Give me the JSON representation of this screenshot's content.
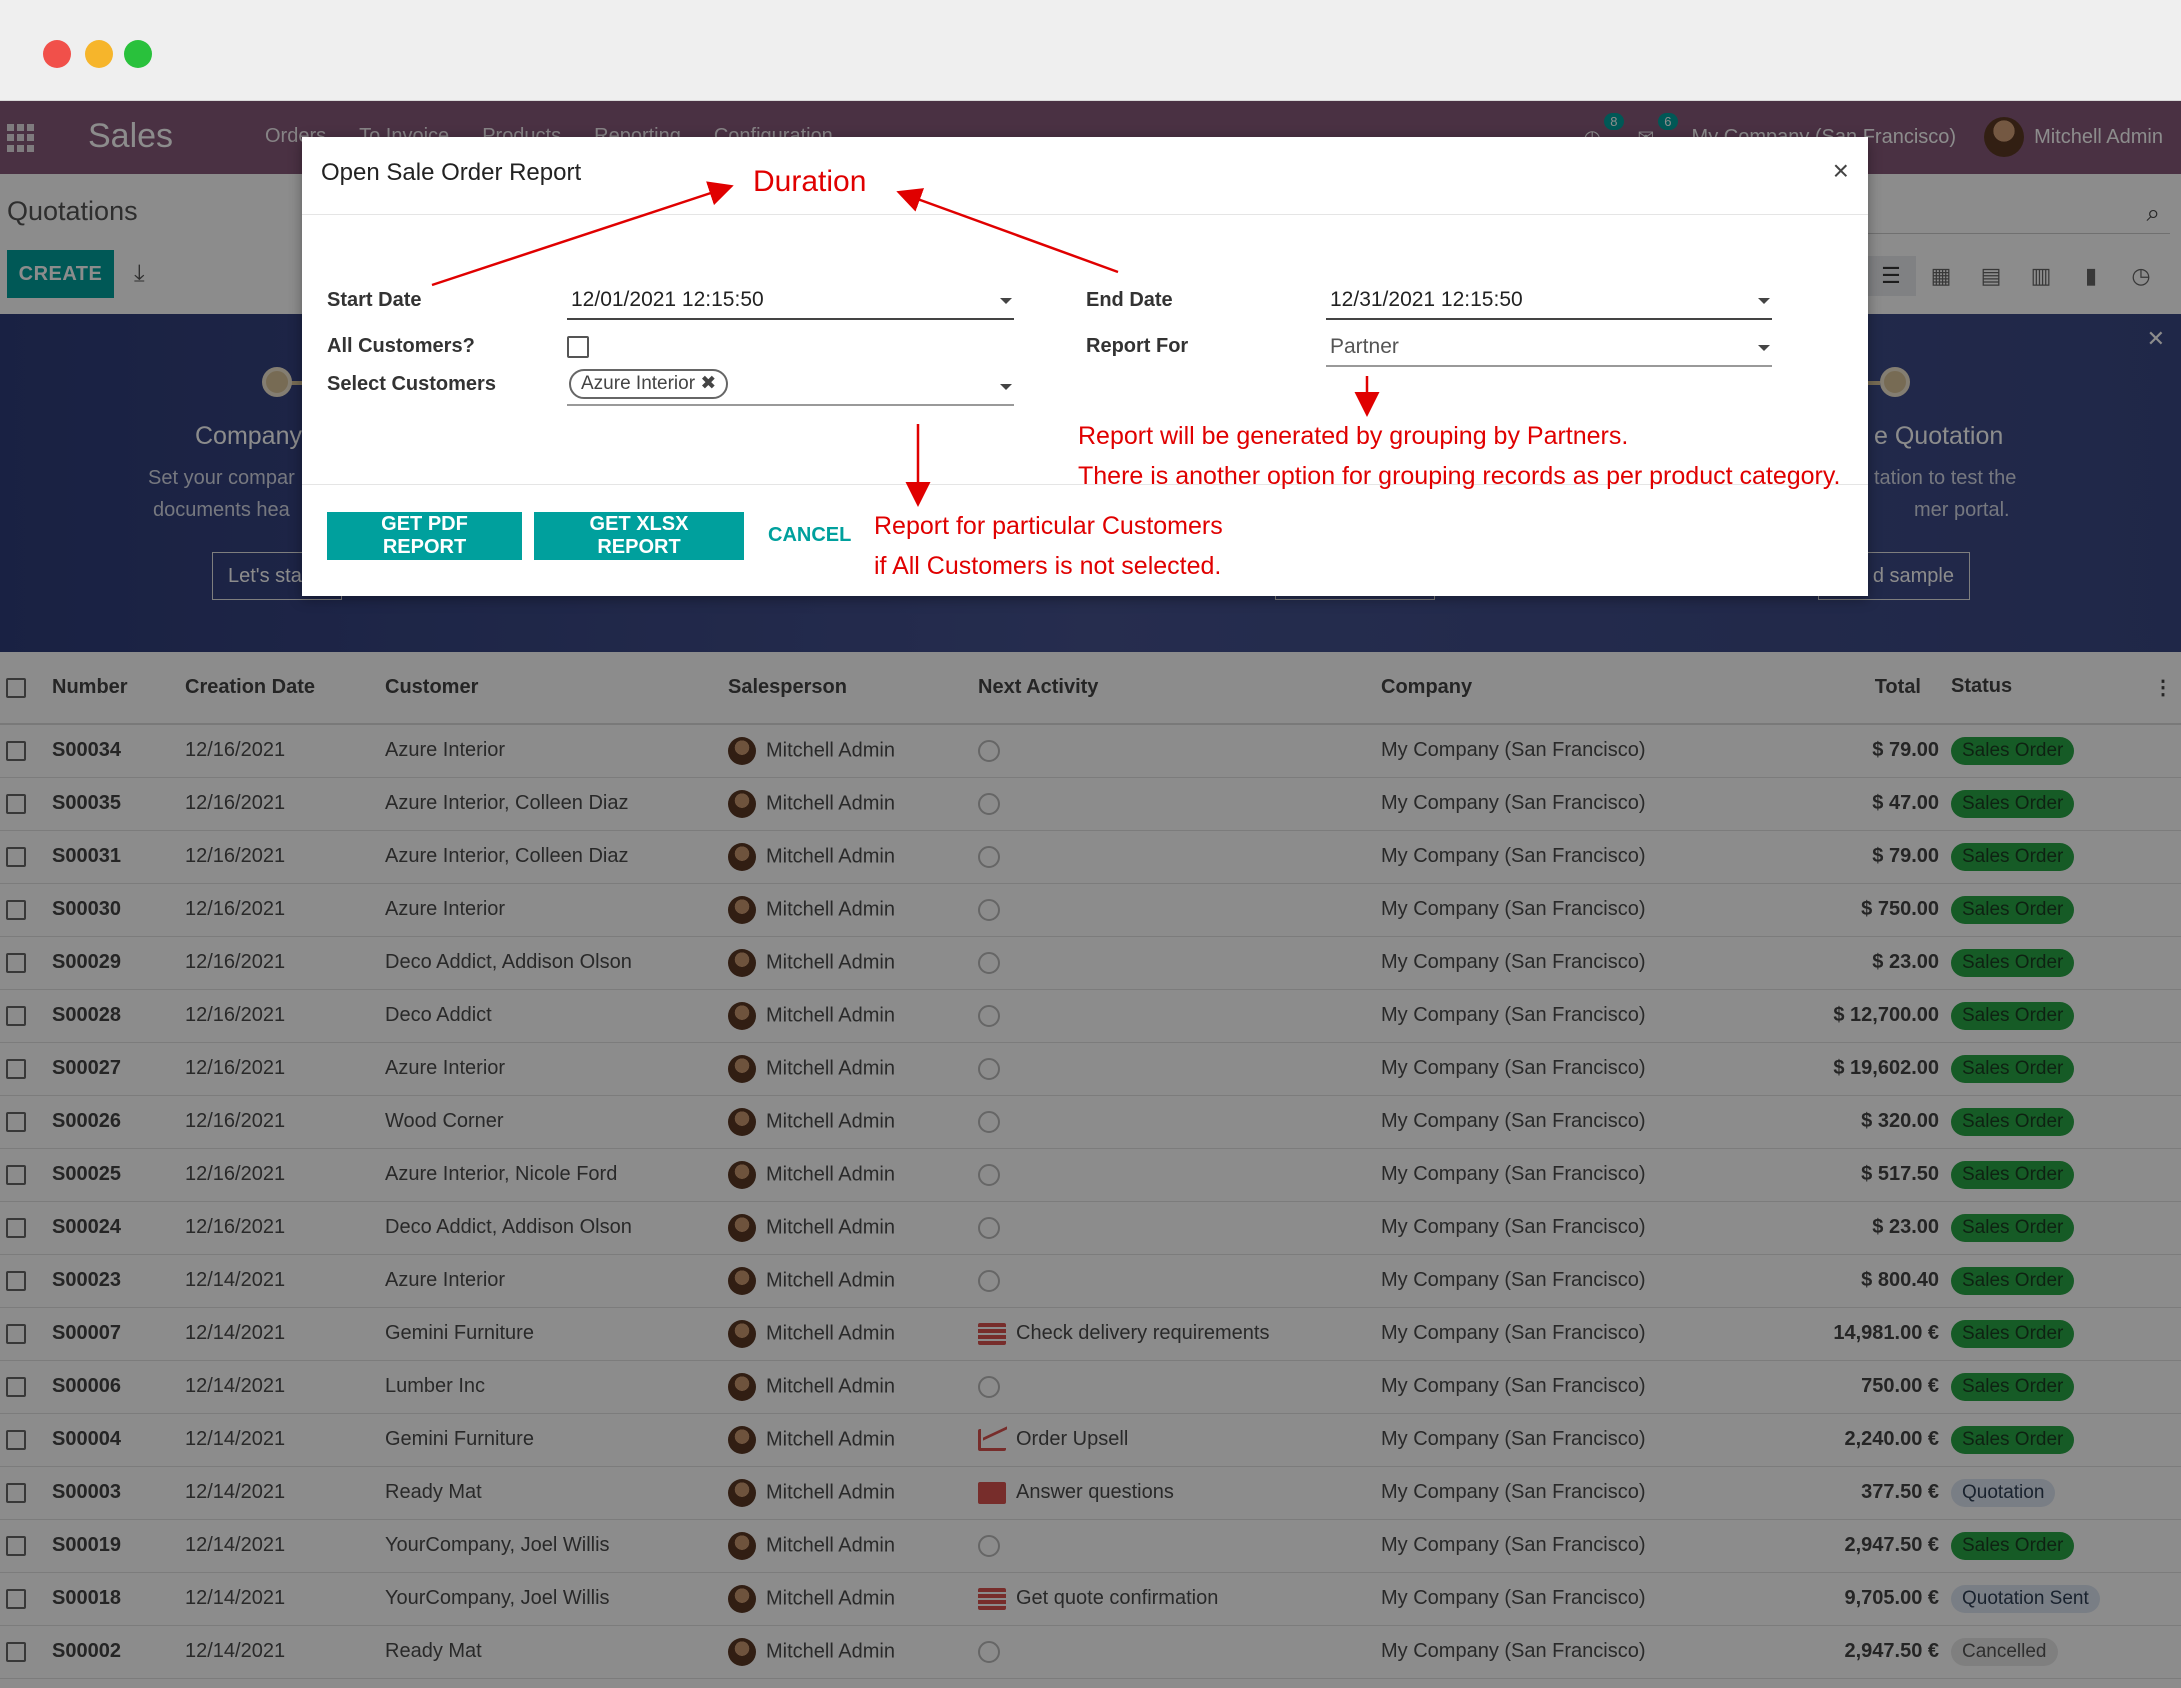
{
  "navbar": {
    "app_title": "Sales",
    "menu": [
      "Orders",
      "To Invoice",
      "Products",
      "Reporting",
      "Configuration"
    ],
    "activity_count": "8",
    "message_count": "6",
    "company": "My Company (San Francisco)",
    "user": "Mitchell Admin"
  },
  "control": {
    "breadcrumb": "Quotations",
    "create_label": "CREATE"
  },
  "banner": {
    "left_title": "Company",
    "left_text_1": "Set your compar",
    "left_text_2": "documents hea",
    "left_button": "Let's sta",
    "right_title": "e Quotation",
    "right_text_1": "tation to test the",
    "right_text_2": "mer portal.",
    "right_button": "d sample"
  },
  "table": {
    "headers": [
      "Number",
      "Creation Date",
      "Customer",
      "Salesperson",
      "Next Activity",
      "Company",
      "Total",
      "Status"
    ],
    "rows": [
      {
        "number": "S00034",
        "date": "12/16/2021",
        "customer": "Azure Interior",
        "salesperson": "Mitchell Admin",
        "activity": "",
        "activity_icon": "clock-icon",
        "company": "My Company (San Francisco)",
        "total": "$ 79.00",
        "status": "Sales Order",
        "status_kind": "sale"
      },
      {
        "number": "S00035",
        "date": "12/16/2021",
        "customer": "Azure Interior, Colleen Diaz",
        "salesperson": "Mitchell Admin",
        "activity": "",
        "activity_icon": "clock-icon",
        "company": "My Company (San Francisco)",
        "total": "$ 47.00",
        "status": "Sales Order",
        "status_kind": "sale"
      },
      {
        "number": "S00031",
        "date": "12/16/2021",
        "customer": "Azure Interior, Colleen Diaz",
        "salesperson": "Mitchell Admin",
        "activity": "",
        "activity_icon": "clock-icon",
        "company": "My Company (San Francisco)",
        "total": "$ 79.00",
        "status": "Sales Order",
        "status_kind": "sale"
      },
      {
        "number": "S00030",
        "date": "12/16/2021",
        "customer": "Azure Interior",
        "salesperson": "Mitchell Admin",
        "activity": "",
        "activity_icon": "clock-icon",
        "company": "My Company (San Francisco)",
        "total": "$ 750.00",
        "status": "Sales Order",
        "status_kind": "sale"
      },
      {
        "number": "S00029",
        "date": "12/16/2021",
        "customer": "Deco Addict, Addison Olson",
        "salesperson": "Mitchell Admin",
        "activity": "",
        "activity_icon": "clock-icon",
        "company": "My Company (San Francisco)",
        "total": "$ 23.00",
        "status": "Sales Order",
        "status_kind": "sale"
      },
      {
        "number": "S00028",
        "date": "12/16/2021",
        "customer": "Deco Addict",
        "salesperson": "Mitchell Admin",
        "activity": "",
        "activity_icon": "clock-icon",
        "company": "My Company (San Francisco)",
        "total": "$ 12,700.00",
        "status": "Sales Order",
        "status_kind": "sale"
      },
      {
        "number": "S00027",
        "date": "12/16/2021",
        "customer": "Azure Interior",
        "salesperson": "Mitchell Admin",
        "activity": "",
        "activity_icon": "clock-icon",
        "company": "My Company (San Francisco)",
        "total": "$ 19,602.00",
        "status": "Sales Order",
        "status_kind": "sale"
      },
      {
        "number": "S00026",
        "date": "12/16/2021",
        "customer": "Wood Corner",
        "salesperson": "Mitchell Admin",
        "activity": "",
        "activity_icon": "clock-icon",
        "company": "My Company (San Francisco)",
        "total": "$ 320.00",
        "status": "Sales Order",
        "status_kind": "sale"
      },
      {
        "number": "S00025",
        "date": "12/16/2021",
        "customer": "Azure Interior, Nicole Ford",
        "salesperson": "Mitchell Admin",
        "activity": "",
        "activity_icon": "clock-icon",
        "company": "My Company (San Francisco)",
        "total": "$ 517.50",
        "status": "Sales Order",
        "status_kind": "sale"
      },
      {
        "number": "S00024",
        "date": "12/16/2021",
        "customer": "Deco Addict, Addison Olson",
        "salesperson": "Mitchell Admin",
        "activity": "",
        "activity_icon": "clock-icon",
        "company": "My Company (San Francisco)",
        "total": "$ 23.00",
        "status": "Sales Order",
        "status_kind": "sale"
      },
      {
        "number": "S00023",
        "date": "12/14/2021",
        "customer": "Azure Interior",
        "salesperson": "Mitchell Admin",
        "activity": "",
        "activity_icon": "clock-icon",
        "company": "My Company (San Francisco)",
        "total": "$ 800.40",
        "status": "Sales Order",
        "status_kind": "sale"
      },
      {
        "number": "S00007",
        "date": "12/14/2021",
        "customer": "Gemini Furniture",
        "salesperson": "Mitchell Admin",
        "activity": "Check delivery requirements",
        "activity_icon": "tasks-icon",
        "company": "My Company (San Francisco)",
        "total": "14,981.00 €",
        "status": "Sales Order",
        "status_kind": "sale"
      },
      {
        "number": "S00006",
        "date": "12/14/2021",
        "customer": "Lumber Inc",
        "salesperson": "Mitchell Admin",
        "activity": "",
        "activity_icon": "clock-icon",
        "company": "My Company (San Francisco)",
        "total": "750.00 €",
        "status": "Sales Order",
        "status_kind": "sale"
      },
      {
        "number": "S00004",
        "date": "12/14/2021",
        "customer": "Gemini Furniture",
        "salesperson": "Mitchell Admin",
        "activity": "Order Upsell",
        "activity_icon": "line-chart-icon",
        "company": "My Company (San Francisco)",
        "total": "2,240.00 €",
        "status": "Sales Order",
        "status_kind": "sale"
      },
      {
        "number": "S00003",
        "date": "12/14/2021",
        "customer": "Ready Mat",
        "salesperson": "Mitchell Admin",
        "activity": "Answer questions",
        "activity_icon": "envelope-icon",
        "company": "My Company (San Francisco)",
        "total": "377.50 €",
        "status": "Quotation",
        "status_kind": "quot"
      },
      {
        "number": "S00019",
        "date": "12/14/2021",
        "customer": "YourCompany, Joel Willis",
        "salesperson": "Mitchell Admin",
        "activity": "",
        "activity_icon": "clock-icon",
        "company": "My Company (San Francisco)",
        "total": "2,947.50 €",
        "status": "Sales Order",
        "status_kind": "sale"
      },
      {
        "number": "S00018",
        "date": "12/14/2021",
        "customer": "YourCompany, Joel Willis",
        "salesperson": "Mitchell Admin",
        "activity": "Get quote confirmation",
        "activity_icon": "tasks-icon",
        "company": "My Company (San Francisco)",
        "total": "9,705.00 €",
        "status": "Quotation Sent",
        "status_kind": "sent"
      },
      {
        "number": "S00002",
        "date": "12/14/2021",
        "customer": "Ready Mat",
        "salesperson": "Mitchell Admin",
        "activity": "",
        "activity_icon": "clock-icon",
        "company": "My Company (San Francisco)",
        "total": "2,947.50 €",
        "status": "Cancelled",
        "status_kind": "canc"
      }
    ]
  },
  "modal": {
    "title": "Open Sale Order Report",
    "close": "×",
    "start_date_label": "Start Date",
    "start_date_value": "12/01/2021 12:15:50",
    "end_date_label": "End Date",
    "end_date_value": "12/31/2021 12:15:50",
    "all_customers_label": "All Customers?",
    "report_for_label": "Report For",
    "report_for_value": "Partner",
    "select_customers_label": "Select Customers",
    "customer_tag": "Azure Interior",
    "pdf_button": "GET PDF REPORT",
    "xlsx_button": "GET XLSX REPORT",
    "cancel_button": "CANCEL"
  },
  "annotations": {
    "duration": "Duration",
    "partner_line_1": "Report will be generated by grouping by Partners.",
    "partner_line_2": "There is another option for grouping records as per product category.",
    "customers_line_1": "Report for particular Customers",
    "customers_line_2": "if All Customers is not selected.",
    "color": "#e00000"
  }
}
